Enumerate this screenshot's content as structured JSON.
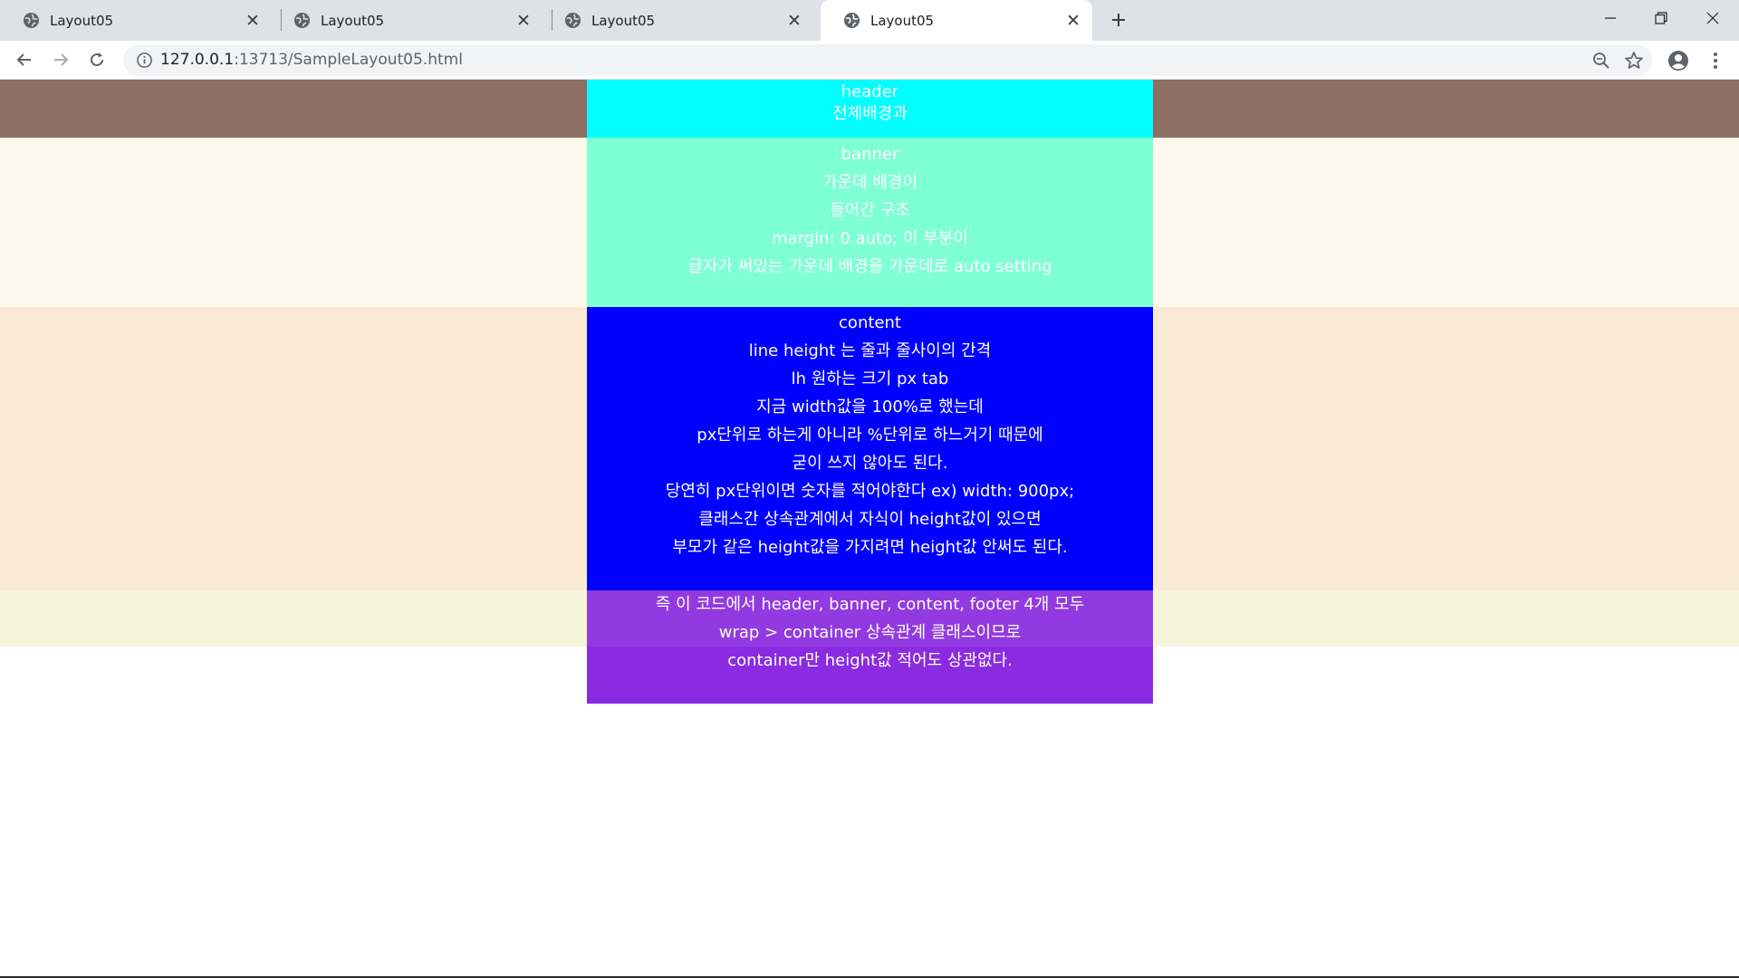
{
  "browser": {
    "tabs": [
      {
        "title": "Layout05",
        "active": false
      },
      {
        "title": "Layout05",
        "active": false
      },
      {
        "title": "Layout05",
        "active": false
      },
      {
        "title": "Layout05",
        "active": true
      }
    ],
    "url_host": "127.0.0.1",
    "url_rest": ":13713/SampleLayout05.html"
  },
  "page": {
    "header_lines": [
      "header",
      "전체배경과"
    ],
    "banner_lines": [
      "banner",
      "가운데 배경이",
      "들어간 구조",
      "margin: 0 auto; 이 부분이",
      "글자가 써있는 가운데 배경을 가운데로 auto setting"
    ],
    "content_lines": [
      "content",
      "line height 는 줄과 줄사이의 간격",
      "lh 원하는 크기 px tab",
      "지금 width값을 100%로 했는데",
      "px단위로 하는게 아니라 %단위로 하느거기 때문에",
      "굳이 쓰지 않아도 된다.",
      "당연히 px단위이면 숫자를 적어야한다 ex) width: 900px;",
      "클래스간 상속관계에서 자식이 height값이 있으면",
      "부모가 같은 height값을 가지려면 height값 안써도 된다."
    ],
    "footer_lines": [
      "즉 이 코드에서 header, banner, content, footer 4개 모두",
      "wrap > container 상속관계 클래스이므로",
      "container만 height값 적어도 상관없다."
    ]
  },
  "colors": {
    "header_bg": "#8d6e63",
    "header_box": "#00ffff",
    "banner_bg": "#fdf9ec",
    "banner_box": "#7fffd4",
    "content_bg": "#f9ead6",
    "content_box": "#0000ff",
    "footer_bg": "#f5f5dc",
    "footer_box": "#8a2be2"
  },
  "icons": {
    "favicon": "globe-icon",
    "tab_close": "close-icon",
    "new_tab": "plus-icon",
    "back": "arrow-left-icon",
    "forward": "arrow-right-icon",
    "reload": "reload-icon",
    "site_info": "info-icon",
    "zoom": "zoom-out-icon",
    "bookmark": "star-icon",
    "profile": "account-icon",
    "menu": "kebab-menu-icon",
    "minimize": "minimize-icon",
    "restore": "restore-icon",
    "close_window": "close-icon"
  }
}
